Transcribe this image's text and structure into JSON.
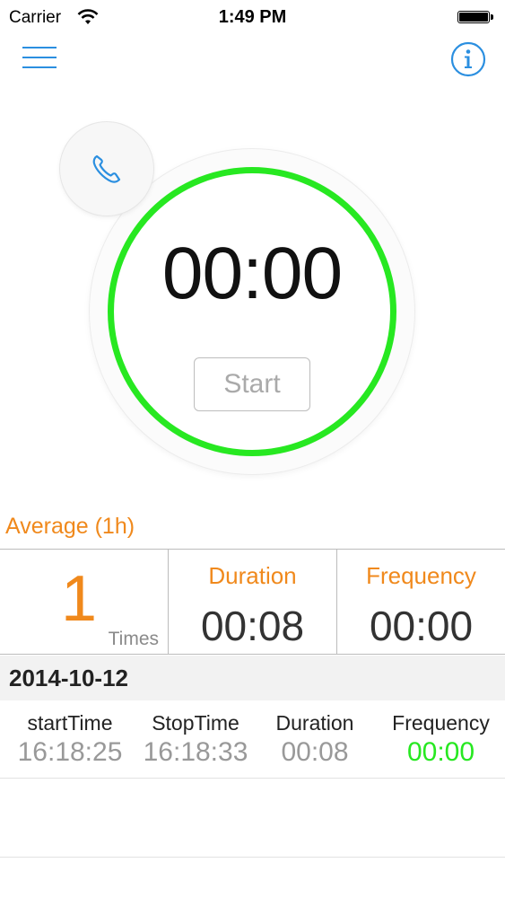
{
  "status_bar": {
    "carrier": "Carrier",
    "time": "1:49 PM"
  },
  "icons": {
    "menu": "hamburger-menu-icon",
    "info": "info-icon",
    "phone": "phone-icon"
  },
  "timer": {
    "display": "00:00",
    "start_label": "Start",
    "ring_color": "#27e821"
  },
  "average": {
    "title": "Average (1h)",
    "count": "1",
    "count_unit": "Times",
    "duration_label": "Duration",
    "duration_value": "00:08",
    "frequency_label": "Frequency",
    "frequency_value": "00:00"
  },
  "log": {
    "date": "2014-10-12",
    "columns": [
      "startTime",
      "StopTime",
      "Duration",
      "Frequency"
    ],
    "rows": [
      {
        "start": "16:18:25",
        "stop": "16:18:33",
        "duration": "00:08",
        "frequency": "00:00"
      }
    ]
  },
  "colors": {
    "accent": "#f0891c",
    "blue": "#2b8fe0",
    "green": "#27e821"
  }
}
